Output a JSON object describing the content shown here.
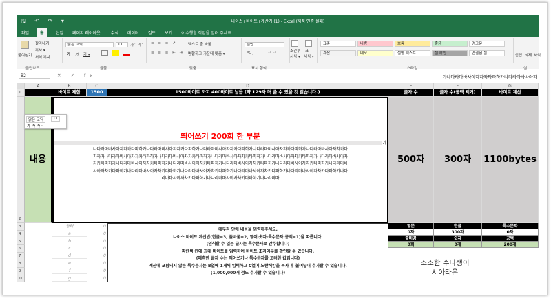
{
  "window": {
    "title": "나이스+바이트+계산기 (1) - Excel (제품 인증 실패)",
    "quick_access": "🖫 ↶ ↷ ▾"
  },
  "tabs": [
    "파일",
    "홈",
    "삽입",
    "페이지 레이아웃",
    "수식",
    "데이터",
    "검토",
    "보기"
  ],
  "tell_me": "♀ 수행할 작업을 알려 주세요.",
  "ribbon": {
    "clipboard": {
      "paste": "붙여넣기",
      "cut": "잘라내기",
      "copy": "복사 ▾",
      "format_painter": "서식 복사",
      "label": "클립보드"
    },
    "font": {
      "name": "맑은 고딕",
      "size": "11",
      "grow": "가ˆ",
      "shrink": "가ˇ",
      "bold": "가",
      "italic": "가",
      "underline": "가 ▾",
      "label": "글꼴"
    },
    "alignment": {
      "wrap": "텍스트 줄 바꿈",
      "merge": "병합하고 가운데 맞춤 ▾",
      "label": "맞춤"
    },
    "number": {
      "format": "일반",
      "percent": "% ,",
      "label": "표시 형식"
    },
    "cond": {
      "conditional": "조건부",
      "conditional2": "서식 ▾",
      "table": "표",
      "table2": "서식 ▾"
    },
    "styles": {
      "items": [
        {
          "label": "표준",
          "color": "#ffffff"
        },
        {
          "label": "나쁨",
          "color": "#ffc7ce"
        },
        {
          "label": "보통",
          "color": "#ffeb9c"
        },
        {
          "label": "좋음",
          "color": "#c6efce"
        },
        {
          "label": "경고문",
          "color": "#ffffff"
        },
        {
          "label": "계산",
          "color": "#f2f2f2"
        },
        {
          "label": "메모",
          "color": "#ffffcc"
        },
        {
          "label": "설명 텍스트",
          "color": "#ffffff"
        },
        {
          "label": "셀 확인",
          "color": "#a5a5a5"
        },
        {
          "label": "연결된 셀",
          "color": "#ffffff"
        }
      ],
      "label": "스타일"
    },
    "cells": {
      "insert": "삽입",
      "delete": "삭제",
      "format": "서식",
      "label": "셀"
    }
  },
  "formula_bar": {
    "name_box": "B2",
    "fx": "✕ ✓ fx",
    "value": "가나다라마바사아자차카타파하가나다라마바사아자"
  },
  "columns": [
    "A",
    "B",
    "C",
    "D",
    "E",
    "F",
    "G"
  ],
  "rows": [
    "1",
    "2",
    "3",
    "4",
    "5",
    "6",
    "7",
    "8",
    "9",
    "10"
  ],
  "sheet": {
    "header": {
      "byte_limit_label": "바이트 제한",
      "byte_limit_value": "1500",
      "status": "1500바이트 까지 400바이트 남음 (약 129자 더 쓸 수 있을 것 같습니다.)",
      "char_count": "글자 수",
      "char_count_nospace": "글자 수(공백 제거)",
      "byte_calc": "바이트 계산"
    },
    "content_label": "내용",
    "space_text": "띄어쓰기 200회 한 부분",
    "edge_char": "가",
    "body_text": [
      "나다라마바사아자차카타파하가나다라마바사아자차카타파하가나다라마바사아자차카타파하가나다라마바사아자차카타파하가나다라마바사아자차카타",
      "파하가나다라마바사아자차카타파하가나다라마바사아자차카타파하가나다라마바사아자차카타파하가나다라마바사아자차카타파하가나다라마바사아자",
      "차카타파하가나다라마바사아자차카타파하가나다라마바사아자차카타파하가나다라마바사아자차카타파하가나다라마바사아자차카타파하가나다라마바",
      "사아자차카타파하가나다라마바사아자차카타파하가나다라마바사아자차카타파하가나다라마바사아자차카타파하가나다라마바사아자차카타파하가나다",
      "라마바사아자차카타파하가나다라마바사아자차카타파하가나다라마바"
    ],
    "totals": {
      "chars": "500자",
      "chars_nospace": "300자",
      "bytes": "1100bytes"
    },
    "mini_toolbar": {
      "font": "맑은 고딕",
      "size": "11",
      "buttons": "가 가 가 ·"
    },
    "row3_label": "영타",
    "letters": [
      "a",
      "b",
      "c",
      "d",
      "e",
      "f",
      "g"
    ],
    "zero": "0",
    "info_lines": [
      "테두리 안에 내용을 입력해주세요.",
      "나이스 바이트 계산법(한글=3, 줄바꿈=2, 영어·숫자·특수문자·공백=1)을 따릅니다.",
      "(인식할 수 없는 글자는 특수문자로 간주합니다)",
      "파란색 칸에 최대 바이트를 입력하여 바이트 초과여부를 확인할 수 있습니다.",
      "(예측한 글자 수는 띄어쓰기나 특수문자를 고려한 값입니다)",
      "계산에 포함되지 않은 특수문자는 B열에 1개씩 입력하고 C열에 노란색칸을 복사 후 붙여넣어 추가할 수 있습니다.",
      "(1,000,000개 정도 추가할 수 있습니다)"
    ],
    "stats": {
      "h1": [
        "영문",
        "한글",
        "특수문자"
      ],
      "v1": [
        "0자",
        "300자",
        "0자"
      ],
      "h2": [
        "줄바꿈",
        "숫자",
        "공백"
      ],
      "v2": [
        "0회",
        "0개",
        "200개"
      ]
    }
  },
  "watermark": {
    "line1": "소소한 수다쟁이",
    "line2": "시아타운"
  },
  "colors": {
    "excel_green": "#217346",
    "blue_cell": "#2f75b5",
    "grey_col": "#d0cece",
    "content_red": "#ff0000"
  }
}
